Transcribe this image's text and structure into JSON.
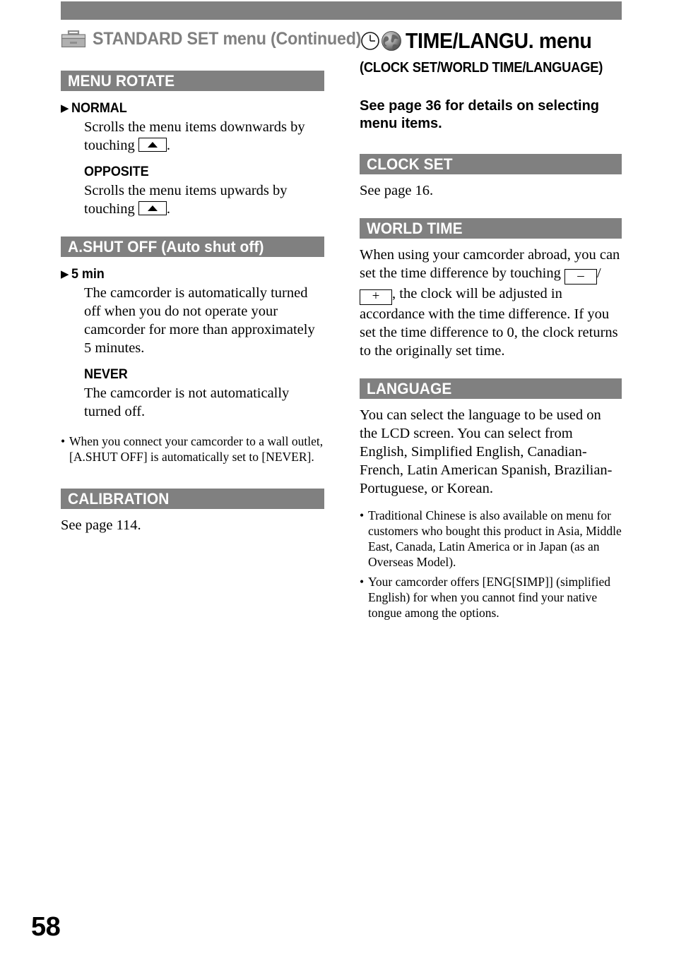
{
  "page": {
    "folio": "58"
  },
  "left_column": {
    "running_head": {
      "icon": "toolbox-icon",
      "title": "STANDARD SET menu (Continued)"
    },
    "sections": [
      {
        "bar_label": "MENU ROTATE",
        "options": [
          {
            "marker": "▶",
            "name": "NORMAL",
            "body_pre": "Scrolls the menu items downwards by touching ",
            "body_post": "."
          },
          {
            "marker": "",
            "name": "OPPOSITE",
            "body_pre": "Scrolls the menu items upwards by touching ",
            "body_post": "."
          }
        ]
      },
      {
        "bar_label": "A.SHUT OFF (Auto shut off)",
        "options": [
          {
            "marker": "▶",
            "name": "5 min",
            "body": "The camcorder is automatically turned off when you do not operate your camcorder for more than approximately 5 minutes."
          },
          {
            "marker": "",
            "name": "NEVER",
            "body": "The camcorder is not automatically turned off."
          }
        ],
        "notes": [
          "When you connect your camcorder to a wall outlet, [A.SHUT OFF] is automatically set to [NEVER]."
        ]
      },
      {
        "bar_label": "CALIBRATION",
        "body": "See page 114."
      }
    ]
  },
  "right_column": {
    "running_head": {
      "icons": [
        "clock-icon",
        "globe-icon"
      ],
      "title": "TIME/LANGU. menu",
      "subtitle": "(CLOCK SET/WORLD TIME/LANGUAGE)"
    },
    "intro": "See page 36 for details on selecting menu items.",
    "sections": [
      {
        "bar_label": "CLOCK SET",
        "body": "See page 16."
      },
      {
        "bar_label": "WORLD TIME",
        "body_part1": "When using your camcorder abroad, you can set the time difference by touching ",
        "minus_glyph": "–",
        "separator": "/",
        "plus_glyph": "+",
        "body_part2": ", the clock will be adjusted in accordance with the time difference.",
        "body_part3": "If you set the time difference to 0, the clock returns to the originally set time."
      },
      {
        "bar_label": "LANGUAGE",
        "body_line1": "You can select the language to be used on the LCD screen.",
        "body_line2": "You can select from English, Simplified English, Canadian-French, Latin American Spanish, Brazilian-Portuguese, or Korean.",
        "notes": [
          "Traditional Chinese is also available on menu for customers who bought this product in Asia, Middle East, Canada, Latin America or in Japan (as an Overseas Model).",
          "Your camcorder offers [ENG[SIMP]] (simplified English) for when you cannot find your native tongue among the options."
        ]
      }
    ]
  },
  "glyphs": {
    "bullet": "•",
    "arrow_up": "up-arrow-key"
  }
}
